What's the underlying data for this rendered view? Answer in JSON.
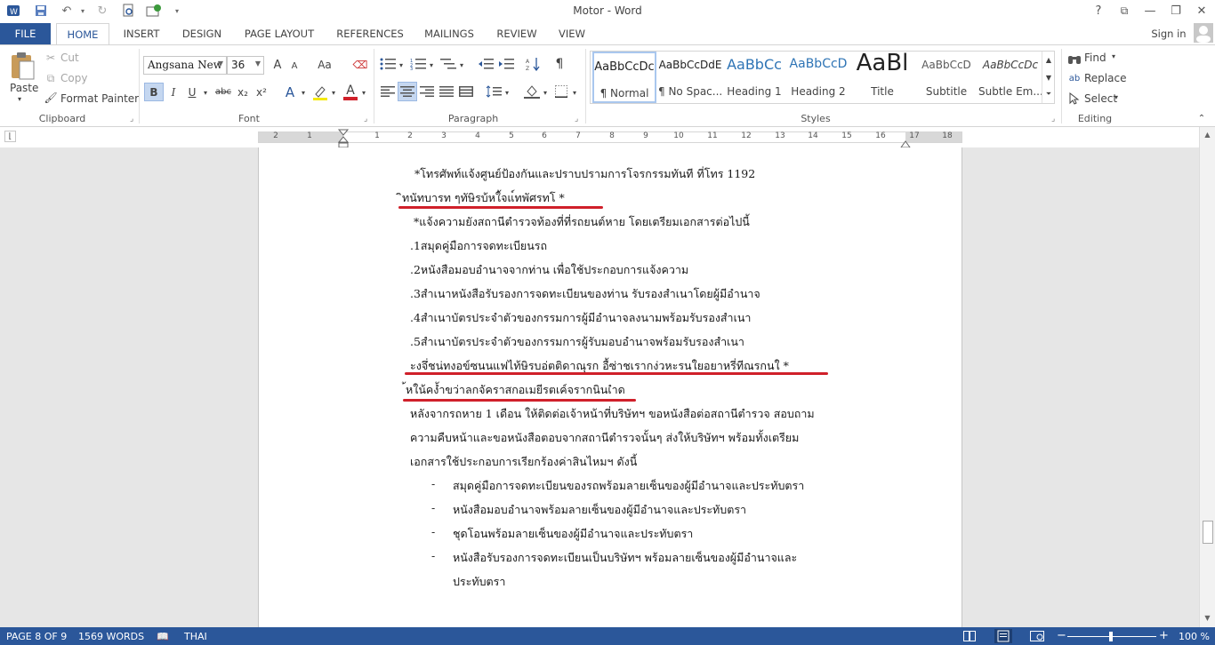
{
  "window": {
    "title": "Motor - Word",
    "controls": {
      "help": "?",
      "ribbon_display": "⧉",
      "minimize": "—",
      "restore": "❐",
      "close": "✕"
    }
  },
  "qat": {
    "undo_icon": "undo-icon",
    "redo_icon": "redo-icon"
  },
  "tabs": [
    "FILE",
    "HOME",
    "INSERT",
    "DESIGN",
    "PAGE LAYOUT",
    "REFERENCES",
    "MAILINGS",
    "REVIEW",
    "VIEW"
  ],
  "active_tab": "HOME",
  "user": {
    "signin": "Sign in"
  },
  "clipboard": {
    "paste": "Paste",
    "cut": "Cut",
    "copy": "Copy",
    "format_painter": "Format Painter",
    "label": "Clipboard"
  },
  "font": {
    "name": "Angsana New",
    "size": "36",
    "label": "Font",
    "bold": "B",
    "italic": "I",
    "underline": "U",
    "strike": "abc",
    "sub": "x₂",
    "sup": "x²",
    "grow": "A",
    "shrink": "A",
    "case": "Aa",
    "effects": "A",
    "color": "A",
    "highlight_color": "#f5e90c",
    "font_color": "#d0202a"
  },
  "paragraph": {
    "label": "Paragraph",
    "pilcrow": "¶"
  },
  "styles": {
    "label": "Styles",
    "items": [
      {
        "preview": "AaBbCcDc",
        "name": "¶ Normal"
      },
      {
        "preview": "AaBbCcDdE",
        "name": "¶ No Spac..."
      },
      {
        "preview": "AaBbCc",
        "name": "Heading 1"
      },
      {
        "preview": "AaBbCcD",
        "name": "Heading 2"
      },
      {
        "preview": "AaBl",
        "name": "Title"
      },
      {
        "preview": "AaBbCcD",
        "name": "Subtitle"
      },
      {
        "preview": "AaBbCcDc",
        "name": "Subtle Em..."
      }
    ]
  },
  "editing": {
    "find": "Find",
    "replace": "Replace",
    "select": "Select",
    "label": "Editing"
  },
  "ruler": {
    "left_numbers": [
      "2",
      "1"
    ],
    "right_numbers": [
      "1",
      "2",
      "3",
      "4",
      "5",
      "6",
      "7",
      "8",
      "9",
      "10",
      "11",
      "12",
      "13",
      "14",
      "15",
      "16",
      "17",
      "18"
    ]
  },
  "document": {
    "lines": [
      " *โทรศัพท์แจ้งศูนย์ป้องกันและปราบปรามการโจรกรรมทันที ที่โทร 1192",
      "ิทนัทบารท ๆทัษิรบ้หใ้จแ์ทพัศรทโ *",
      " *แจ้งความยังสถานีตำรวจท้องที่ที่รถยนต์หาย โดยเตรียมเอกสารต่อไปนี้",
      ".1สมุดคู่มือการจดทะเบียนรถ",
      ".2หนังสือมอบอำนาจจากท่าน เพื่อใช้ประกอบการแจ้งความ",
      ".3สำเนาหนังสือรับรองการจดทะเบียนของท่าน รับรองสำเนาโดยผู้มีอำนาจ",
      ".4สำเนาบัตรประจำตัวของกรรมการผู้มีอำนาจลงนามพร้อมรับรองสำเนา",
      ".5สำเนาบัตรประจำตัวของกรรมการผู้รับมอบอำนาจพร้อมรับรองสำเนา",
      "ะงจึ่ชน่ทงอข์ซนนแฟไท้ษิรบอ่ตติดาณุรก อื้ซ่าชเรากง่วหะรนใยอยาหรี่ทีณรกนใ *",
      "้หใน้คง้ำขว่าลกจัคราสกอเมยีรตเค์จรากนินเำด",
      "หลังจากรถหาย 1 เดือน ให้ติดต่อเจ้าหน้าที่บริษัทฯ ขอหนังสือต่อสถานีตำรวจ สอบถาม",
      "ความคืบหน้าและขอหนังสือตอบจากสถานีตำรวจนั้นๆ ส่งให้บริษัทฯ พร้อมทั้งเตรียม",
      "เอกสารใช้ประกอบการเรียกร้องค่าสินไหมฯ ดังนี้"
    ],
    "bullet_char": "-",
    "bullets": [
      "สมุดคู่มือการจดทะเบียนของรถพร้อมลายเซ็นของผู้มีอำนาจและประทับตรา",
      "หนังสือมอบอำนาจพร้อมลายเซ็นของผู้มีอำนาจและประทับตรา",
      "ชุดโอนพร้อมลายเซ็นของผู้มีอำนาจและประทับตรา",
      "หนังสือรับรองการจดทะเบียนเป็นบริษัทฯ พร้อมลายเซ็นของผู้มีอำนาจและ"
    ],
    "bullet_continuation": "ประทับตรา",
    "annotation_color": "#d0202a"
  },
  "status": {
    "page": "PAGE 8 OF 9",
    "words": "1569 WORDS",
    "language": "THAI",
    "zoom": "100 %",
    "zoom_minus": "−",
    "zoom_plus": "+"
  },
  "colors": {
    "accent": "#2b579a",
    "canvas": "#e6e6e6"
  }
}
